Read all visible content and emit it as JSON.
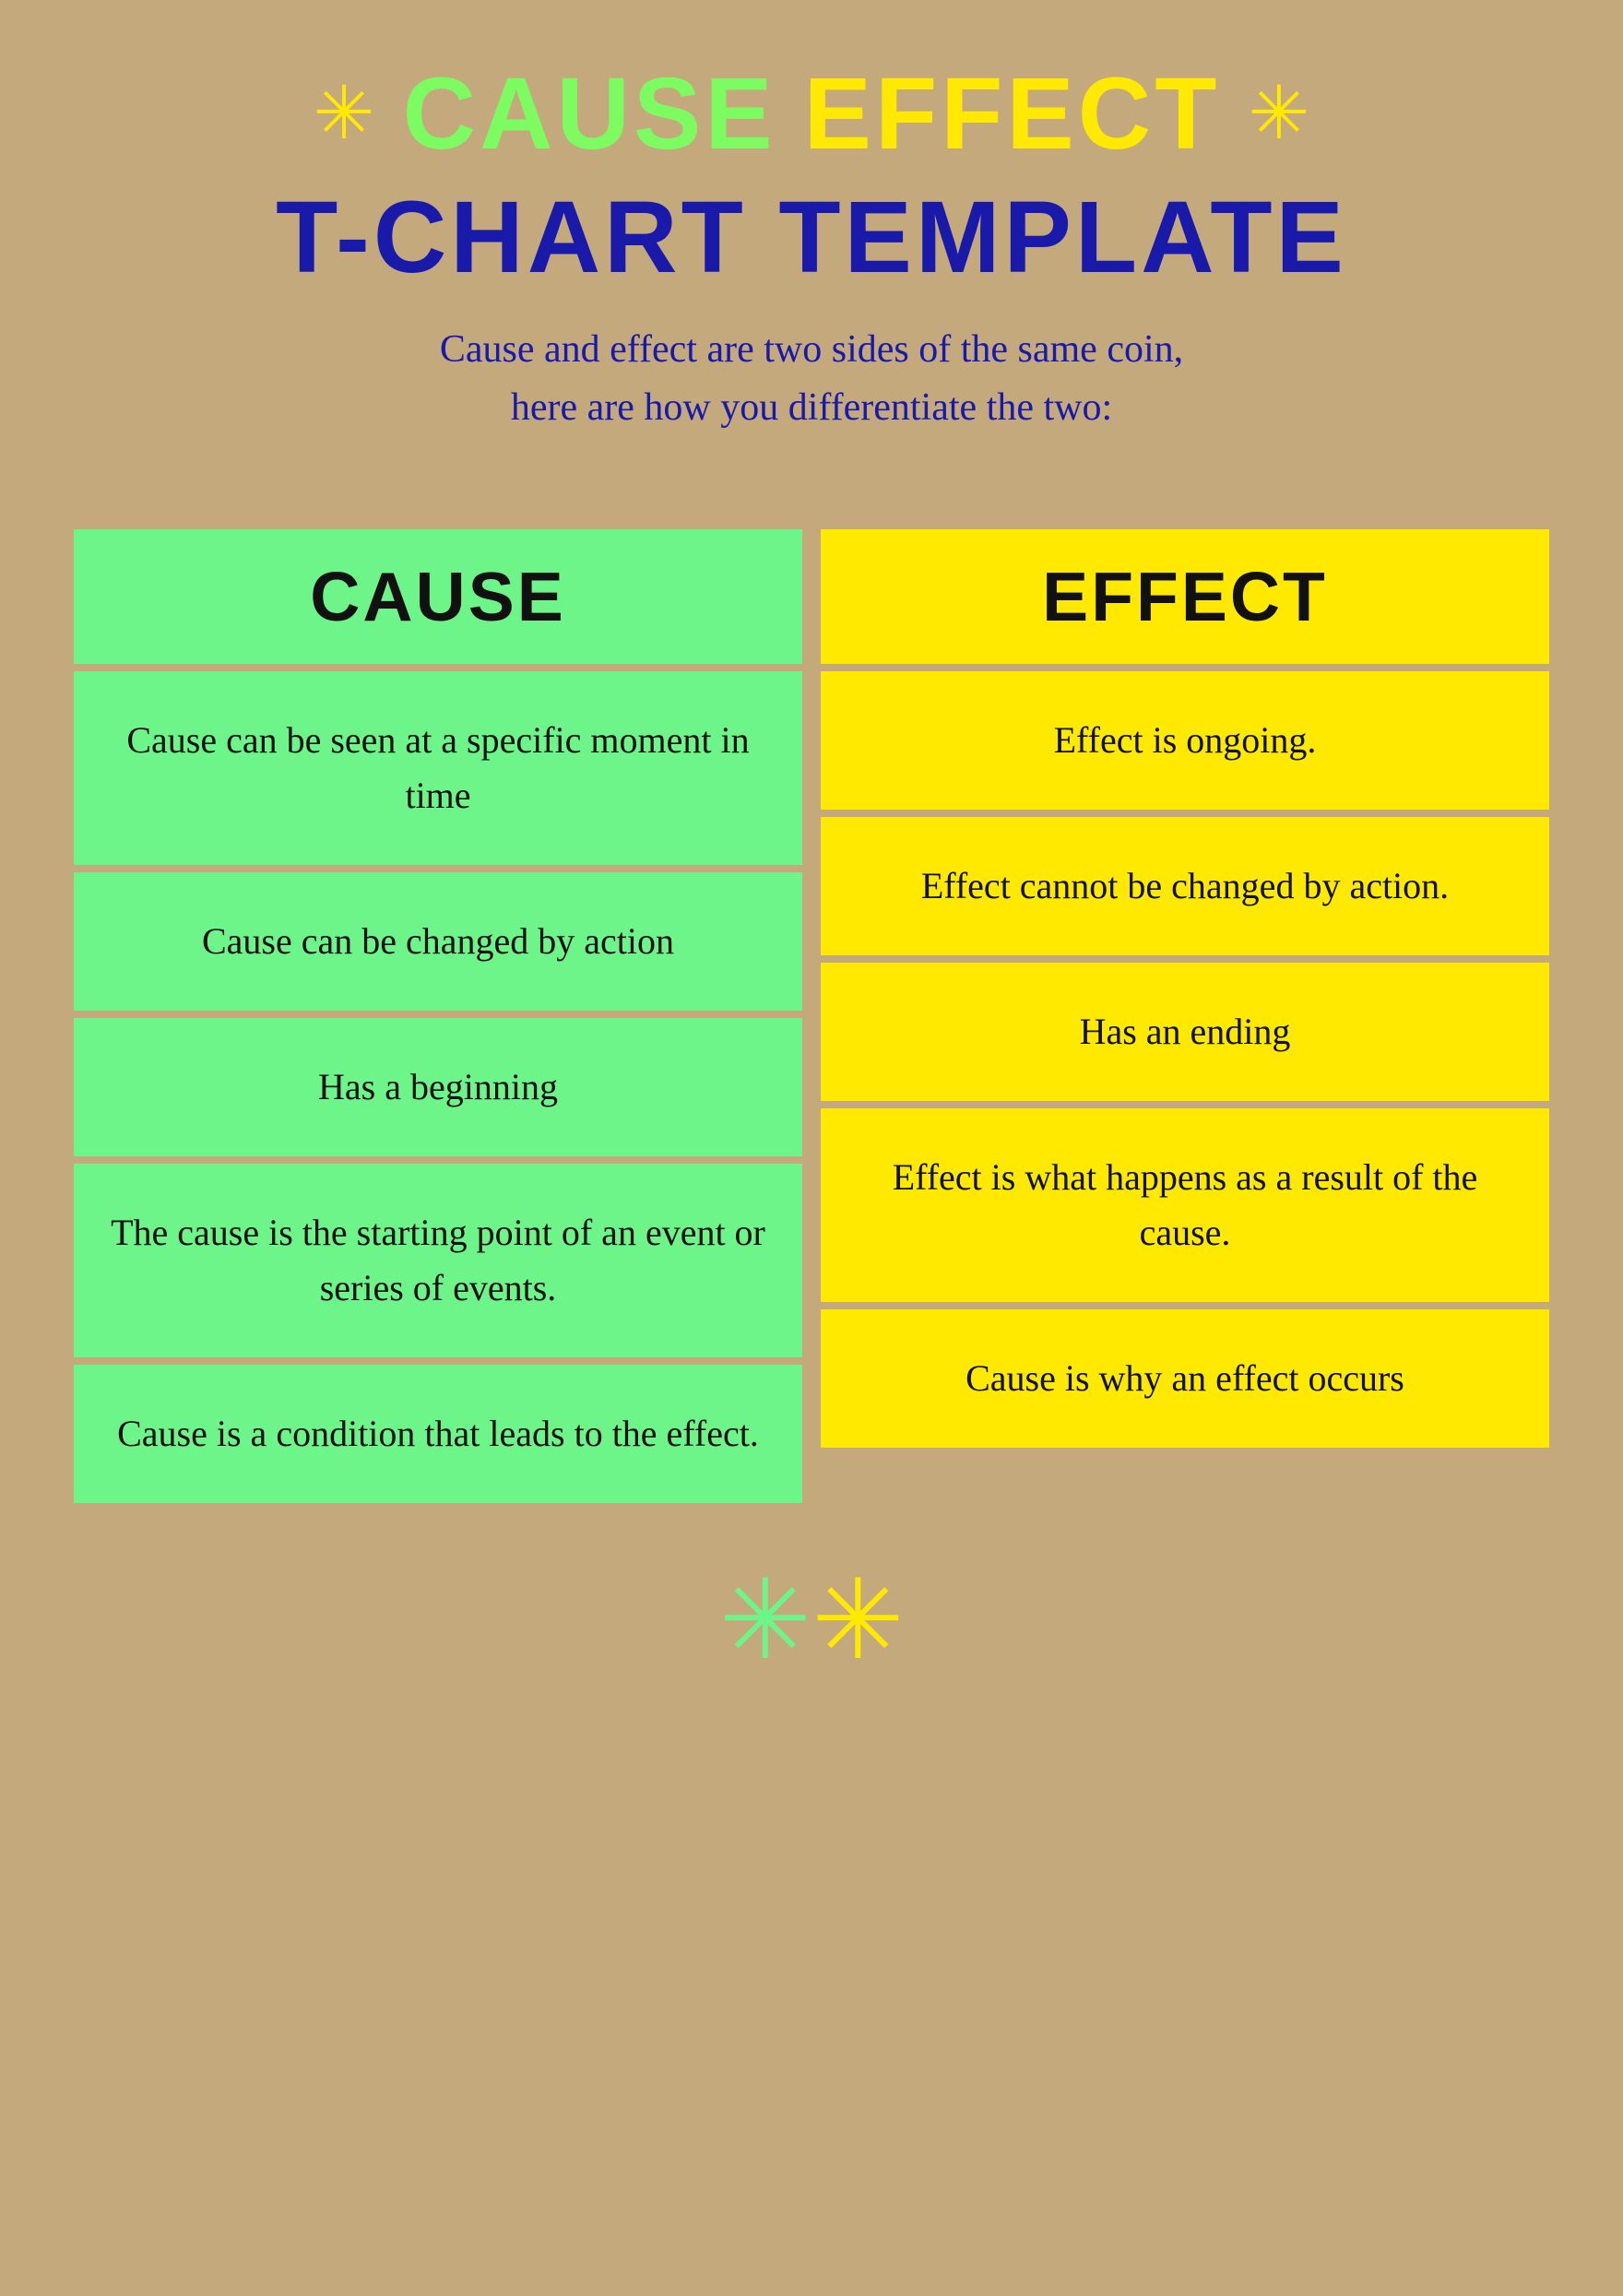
{
  "header": {
    "title_cause": "CAUSE",
    "title_effect": "EFFECT",
    "title_line2": "T-CHART TEMPLATE",
    "subtitle": "Cause and effect are two sides of the same coin,\nhere are how you differentiate the two:"
  },
  "cause_column": {
    "header": "CAUSE",
    "cells": [
      "Cause can be seen at a specific moment in time",
      "Cause can be changed by action",
      "Has a beginning",
      "The cause is the starting point of an event or series of events.",
      "Cause is a condition that leads to the effect."
    ]
  },
  "effect_column": {
    "header": "EFFECT",
    "cells": [
      "Effect is ongoing.",
      "Effect cannot be changed by action.",
      "Has an ending",
      "Effect is what happens as a result of the cause.",
      "Cause is why an effect occurs"
    ]
  }
}
